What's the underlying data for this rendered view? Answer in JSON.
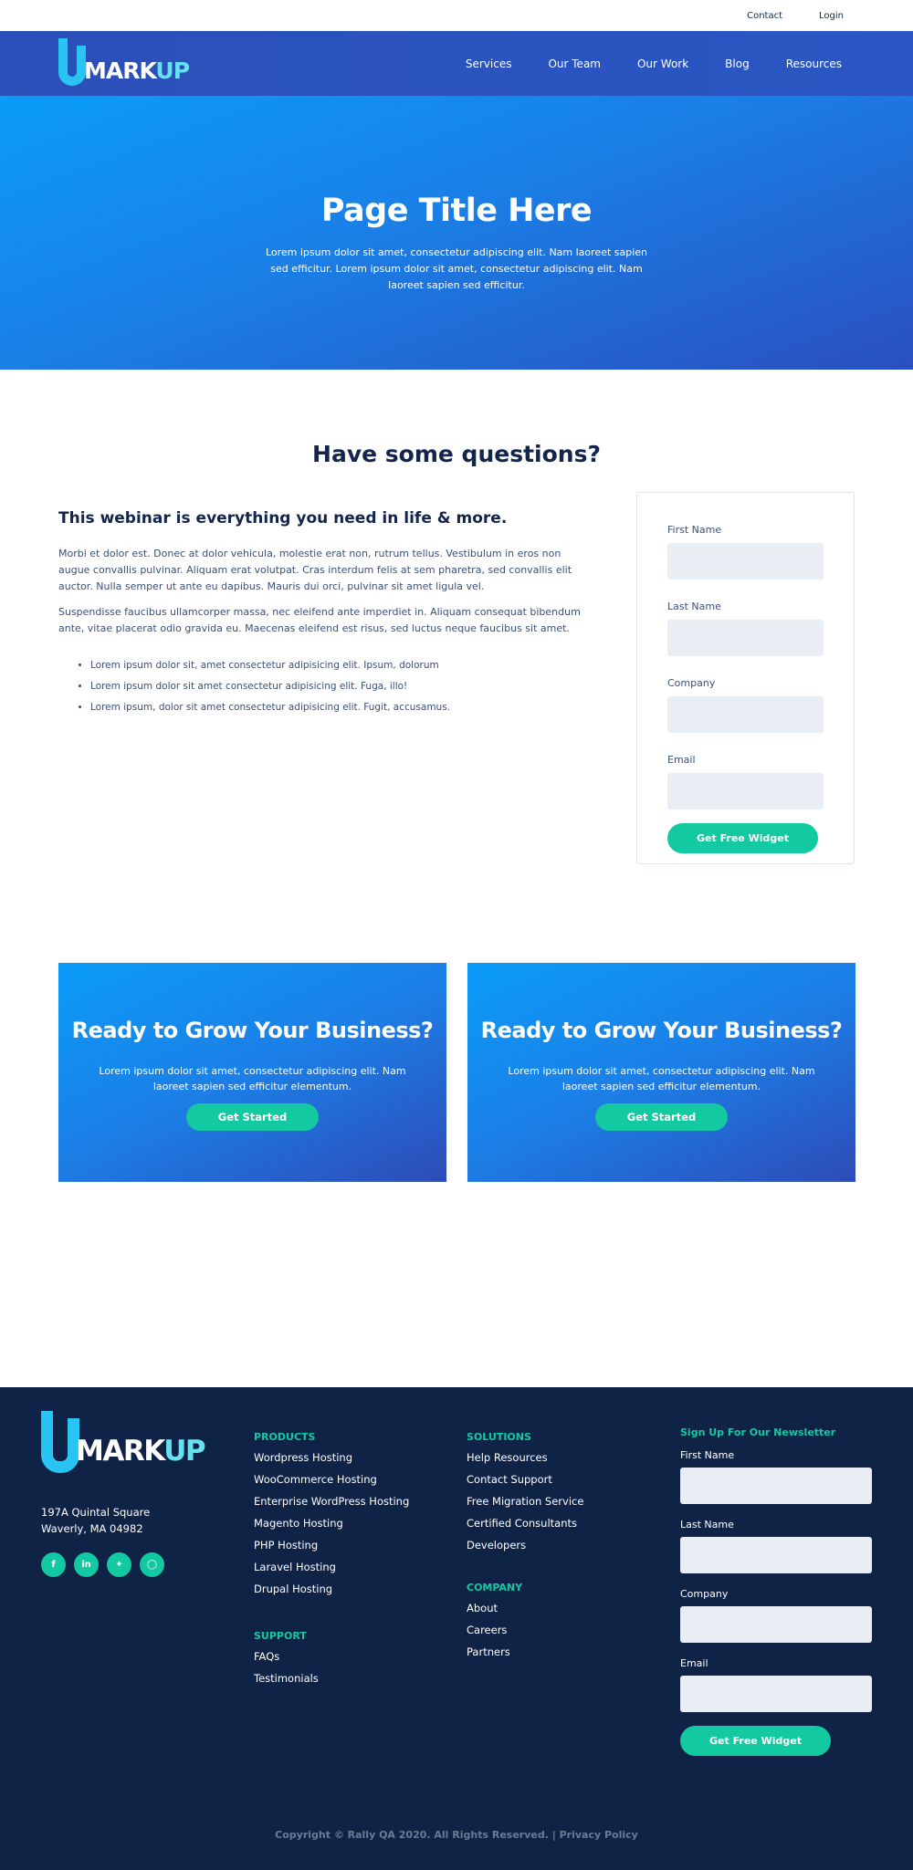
{
  "utility": {
    "contact": "Contact",
    "login": "Login"
  },
  "brand": {
    "letter": "U",
    "mark": "MARK",
    "up": "UP"
  },
  "nav": [
    "Services",
    "Our Team",
    "Our Work",
    "Blog",
    "Resources"
  ],
  "hero": {
    "title": "Page Title Here",
    "text": "Lorem ipsum dolor sit amet, consectetur adipiscing elit. Nam laoreet sapien sed efficitur. Lorem ipsum dolor sit amet, consectetur adipiscing elit. Nam laoreet sapien sed efficitur."
  },
  "questions": {
    "heading": "Have some questions?",
    "subheading": "This webinar is everything you need in life & more.",
    "para1": "Morbi et dolor est. Donec at dolor vehicula, molestie erat non, rutrum tellus. Vestibulum in eros non augue convallis pulvinar. Aliquam erat volutpat. Cras interdum felis at sem pharetra, sed convallis elit auctor. Nulla semper ut ante eu dapibus. Mauris dui orci, pulvinar sit amet ligula vel.",
    "para2": "Suspendisse faucibus ullamcorper massa, nec eleifend ante imperdiet in. Aliquam consequat bibendum ante, vitae placerat odio gravida eu. Maecenas eleifend est risus, sed luctus neque faucibus sit amet.",
    "bullets": [
      "Lorem ipsum dolor sit, amet consectetur adipisicing elit. Ipsum, dolorum",
      "Lorem ipsum dolor sit amet consectetur adipisicing elit. Fuga, illo!",
      "Lorem ipsum, dolor sit amet consectetur adipisicing elit. Fugit, accusamus."
    ]
  },
  "form": {
    "first_name": "First Name",
    "last_name": "Last Name",
    "company": "Company",
    "email": "Email",
    "submit": "Get Free Widget"
  },
  "cta": [
    {
      "title": "Ready to Grow Your Business?",
      "text": "Lorem ipsum dolor sit amet, consectetur adipiscing elit. Nam laoreet sapien sed efficitur elementum.",
      "button": "Get Started"
    },
    {
      "title": "Ready to Grow Your Business?",
      "text": "Lorem ipsum dolor sit amet, consectetur adipiscing elit. Nam laoreet sapien sed efficitur elementum.",
      "button": "Get Started"
    }
  ],
  "footer": {
    "address_line1": "197A Quintal Square",
    "address_line2": "Waverly, MA 04982",
    "social": [
      "facebook-icon",
      "linkedin-icon",
      "twitter-icon",
      "instagram-icon"
    ],
    "products": {
      "heading": "PRODUCTS",
      "links": [
        "Wordpress Hosting",
        "WooCommerce Hosting",
        "Enterprise WordPress Hosting",
        "Magento Hosting",
        "PHP Hosting",
        "Laravel Hosting",
        "Drupal Hosting"
      ]
    },
    "support": {
      "heading": "SUPPORT",
      "links": [
        "FAQs",
        "Testimonials"
      ]
    },
    "solutions": {
      "heading": "SOLUTIONS",
      "links": [
        "Help Resources",
        "Contact Support",
        "Free Migration Service",
        "Certified Consultants",
        "Developers"
      ]
    },
    "company": {
      "heading": "COMPANY",
      "links": [
        "About",
        "Careers",
        "Partners"
      ]
    },
    "newsletter": {
      "heading": "Sign Up For Our Newsletter",
      "first_name": "First Name",
      "last_name": "Last Name",
      "company": "Company",
      "email": "Email",
      "submit": "Get Free Widget"
    },
    "copyright": "Copyright © Rally QA 2020. All Rights Reserved. |",
    "privacy": "Privacy Policy"
  },
  "colors": {
    "accent": "#13c9a1",
    "nav_bg": "#2b4fb8",
    "footer_bg": "#0f2346",
    "hero_start": "#0a9cf8",
    "hero_end": "#2a4fbf"
  }
}
